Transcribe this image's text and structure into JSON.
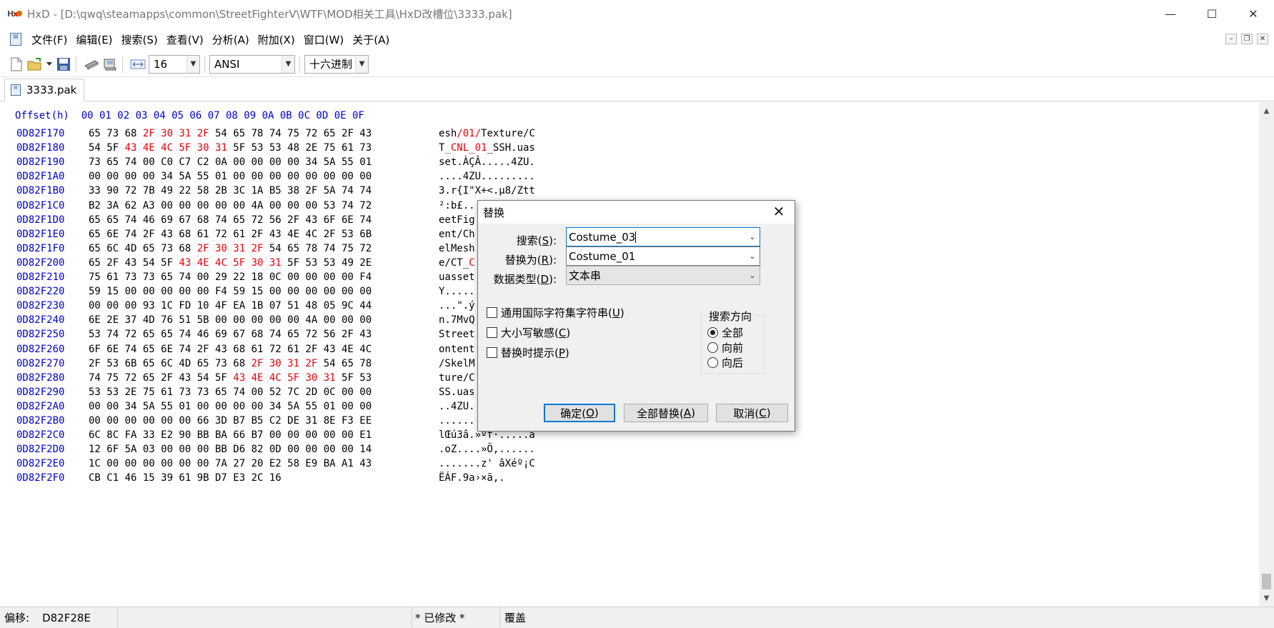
{
  "window": {
    "title": "HxD - [D:\\qwq\\steamapps\\common\\StreetFighterV\\WTF\\MOD相关工具\\HxD改槽位\\3333.pak]",
    "app_icon_text": "HxD",
    "minimize": "—",
    "maximize": "☐",
    "close": "✕"
  },
  "menu": {
    "items": [
      "文件(F)",
      "编辑(E)",
      "搜索(S)",
      "查看(V)",
      "分析(A)",
      "附加(X)",
      "窗口(W)",
      "关于(A)"
    ],
    "mdi": {
      "minimize": "–",
      "restore": "❐",
      "close": "✕"
    }
  },
  "toolbar": {
    "bytes_per_row": "16",
    "charset": "ANSI",
    "offset_base": "十六进制"
  },
  "tab": {
    "label": "3333.pak"
  },
  "hex": {
    "header": "Offset(h)  00 01 02 03 04 05 06 07 08 09 0A 0B 0C 0D 0E 0F",
    "rows": [
      {
        "offset": "0D82F170",
        "bytes": [
          [
            "65 73 68 ",
            0
          ],
          [
            "2F 30 31 2F",
            1
          ],
          [
            " 54 65 78 74 75 72 65 2F 43",
            0
          ]
        ],
        "text": [
          [
            "esh",
            0
          ],
          [
            "/01/",
            1
          ],
          [
            "Texture/C",
            0
          ]
        ]
      },
      {
        "offset": "0D82F180",
        "bytes": [
          [
            "54 5F ",
            0
          ],
          [
            "43 4E 4C 5F 30 31",
            1
          ],
          [
            " 5F 53 53 48 2E 75 61 73",
            0
          ]
        ],
        "text": [
          [
            "T",
            0
          ],
          [
            "_CNL_01",
            1
          ],
          [
            "_SSH.uas",
            0
          ]
        ]
      },
      {
        "offset": "0D82F190",
        "bytes": [
          [
            "73 65 74 00 C0 C7 C2 0A 00 00 00 00 34 5A 55 01",
            0
          ]
        ],
        "text": [
          [
            "set.ÀÇÂ.....4ZU.",
            0
          ]
        ]
      },
      {
        "offset": "0D82F1A0",
        "bytes": [
          [
            "00 00 00 00 34 5A 55 01 00 00 00 00 00 00 00 00",
            0
          ]
        ],
        "text": [
          [
            "....4ZU.........",
            0
          ]
        ]
      },
      {
        "offset": "0D82F1B0",
        "bytes": [
          [
            "33 90 72 7B 49 22 58 2B 3C 1A B5 38 2F 5A 74 74",
            0
          ]
        ],
        "text": [
          [
            "3.r{I\"X+<.µ8/Ztt",
            0
          ]
        ]
      },
      {
        "offset": "0D82F1C0",
        "bytes": [
          [
            "B2 3A 62 A3 00 00 00 00 00 4A 00 00 00 53 74 72",
            0
          ]
        ],
        "text": [
          [
            "²:b£....",
            0
          ]
        ]
      },
      {
        "offset": "0D82F1D0",
        "bytes": [
          [
            "65 65 74 46 69 67 68 74 65 72 56 2F 43 6F 6E 74",
            0
          ]
        ],
        "text": [
          [
            "eetFig",
            0
          ]
        ]
      },
      {
        "offset": "0D82F1E0",
        "bytes": [
          [
            "65 6E 74 2F 43 68 61 72 61 2F 43 4E 4C 2F 53 6B",
            0
          ]
        ],
        "text": [
          [
            "ent/Ch",
            0
          ]
        ]
      },
      {
        "offset": "0D82F1F0",
        "bytes": [
          [
            "65 6C 4D 65 73 68 ",
            0
          ],
          [
            "2F 30 31 2F",
            1
          ],
          [
            " 54 65 78 74 75 72",
            0
          ]
        ],
        "text": [
          [
            "elMesh",
            0
          ]
        ]
      },
      {
        "offset": "0D82F200",
        "bytes": [
          [
            "65 2F 43 54 5F ",
            0
          ],
          [
            "43 4E 4C 5F 30 31",
            1
          ],
          [
            " 5F 53 53 49 2E",
            0
          ]
        ],
        "text": [
          [
            "e/CT_",
            0
          ],
          [
            "C",
            1
          ]
        ]
      },
      {
        "offset": "0D82F210",
        "bytes": [
          [
            "75 61 73 73 65 74 00 29 22 18 0C 00 00 00 00 F4",
            0
          ]
        ],
        "text": [
          [
            "uasset",
            0
          ]
        ]
      },
      {
        "offset": "0D82F220",
        "bytes": [
          [
            "59 15 00 00 00 00 00 F4 59 15 00 00 00 00 00 00",
            0
          ]
        ],
        "text": [
          [
            "Y.....",
            0
          ]
        ]
      },
      {
        "offset": "0D82F230",
        "bytes": [
          [
            "00 00 00 93 1C FD 10 4F EA 1B 07 51 48 05 9C 44",
            0
          ]
        ],
        "text": [
          [
            "...\".ý",
            0
          ]
        ]
      },
      {
        "offset": "0D82F240",
        "bytes": [
          [
            "6E 2E 37 4D 76 51 5B 00 00 00 00 00 4A 00 00 00",
            0
          ]
        ],
        "text": [
          [
            "n.7MvQ",
            0
          ]
        ]
      },
      {
        "offset": "0D82F250",
        "bytes": [
          [
            "53 74 72 65 65 74 46 69 67 68 74 65 72 56 2F 43",
            0
          ]
        ],
        "text": [
          [
            "Street",
            0
          ]
        ]
      },
      {
        "offset": "0D82F260",
        "bytes": [
          [
            "6F 6E 74 65 6E 74 2F 43 68 61 72 61 2F 43 4E 4C",
            0
          ]
        ],
        "text": [
          [
            "ontent",
            0
          ]
        ]
      },
      {
        "offset": "0D82F270",
        "bytes": [
          [
            "2F 53 6B 65 6C 4D 65 73 68 ",
            0
          ],
          [
            "2F 30 31 2F",
            1
          ],
          [
            " 54 65 78",
            0
          ]
        ],
        "text": [
          [
            "/SkelM",
            0
          ]
        ]
      },
      {
        "offset": "0D82F280",
        "bytes": [
          [
            "74 75 72 65 2F 43 54 5F ",
            0
          ],
          [
            "43 4E 4C 5F 30 31",
            1
          ],
          [
            " 5F 53",
            0
          ]
        ],
        "text": [
          [
            "ture/C",
            0
          ]
        ]
      },
      {
        "offset": "0D82F290",
        "bytes": [
          [
            "53 53 2E 75 61 73 73 65 74 00 52 7C 2D 0C 00 00",
            0
          ]
        ],
        "text": [
          [
            "SS.uas",
            0
          ]
        ]
      },
      {
        "offset": "0D82F2A0",
        "bytes": [
          [
            "00 00 34 5A 55 01 00 00 00 00 34 5A 55 01 00 00",
            0
          ]
        ],
        "text": [
          [
            "..4ZU.",
            0
          ]
        ]
      },
      {
        "offset": "0D82F2B0",
        "bytes": [
          [
            "00 00 00 00 00 00 66 3D B7 B5 C2 DE 31 8E F3 EE",
            0
          ]
        ],
        "text": [
          [
            "......",
            0
          ]
        ]
      },
      {
        "offset": "0D82F2C0",
        "bytes": [
          [
            "6C 8C FA 33 E2 90 BB BA 66 B7 00 00 00 00 00 E1",
            0
          ]
        ],
        "text": [
          [
            "lŒú3â.»ºf·.....á",
            0
          ]
        ]
      },
      {
        "offset": "0D82F2D0",
        "bytes": [
          [
            "12 6F 5A 03 00 00 00 BB D6 82 0D 00 00 00 00 14",
            0
          ]
        ],
        "text": [
          [
            ".oZ....»Ö‚......",
            0
          ]
        ]
      },
      {
        "offset": "0D82F2E0",
        "bytes": [
          [
            "1C 00 00 00 00 00 00 7A 27 20 E2 58 E9 BA A1 43",
            0
          ]
        ],
        "text": [
          [
            ".......z' âXéº¡C",
            0
          ]
        ]
      },
      {
        "offset": "0D82F2F0",
        "bytes": [
          [
            "CB C1 46 15 39 61 9B D7 E3 2C 16",
            0
          ]
        ],
        "text": [
          [
            "ËÁF.9a›×ã,.",
            0
          ]
        ]
      }
    ]
  },
  "status": {
    "offset_label": "偏移:",
    "offset_value": "D82F28E",
    "modified": "* 已修改 *",
    "mode": "覆盖"
  },
  "dialog": {
    "title": "替换",
    "close": "✕",
    "search_label": "搜索(S):",
    "search_label_pre": "搜索(",
    "search_label_key": "S",
    "search_label_post": "):",
    "search_value": "Costume_03",
    "replace_label_pre": "替换为(",
    "replace_label_key": "R",
    "replace_label_post": "):",
    "replace_value": "Costume_01",
    "datatype_label_pre": "数据类型(",
    "datatype_label_key": "D",
    "datatype_label_post": "):",
    "datatype_value": "文本串",
    "opt_unicode_pre": "通用国际字符集字符串(",
    "opt_unicode_key": "U",
    "opt_case_pre": "大小写敏感(",
    "opt_case_key": "C",
    "opt_prompt_pre": "替换时提示(",
    "opt_prompt_key": "P",
    "close_paren": ")",
    "direction_title": "搜索方向",
    "dir_all": "全部",
    "dir_forward": "向前",
    "dir_backward": "向后",
    "ok_pre": "确定(",
    "ok_key": "O",
    "replace_all_pre": "全部替换(",
    "replace_all_key": "A",
    "cancel_pre": "取消(",
    "cancel_key": "C"
  },
  "colors": {
    "offset_blue": "#0000cc",
    "highlight_red": "#e8000b",
    "dialog_bg": "#f0f0f0",
    "focus_blue": "#0078d7"
  },
  "icons": [
    "app-hxd-icon",
    "document-icon",
    "new-file-icon",
    "open-file-icon",
    "save-icon",
    "ram-icon",
    "disk-icon",
    "bytes-per-row-icon",
    "chevron-down-icon",
    "close-icon"
  ]
}
